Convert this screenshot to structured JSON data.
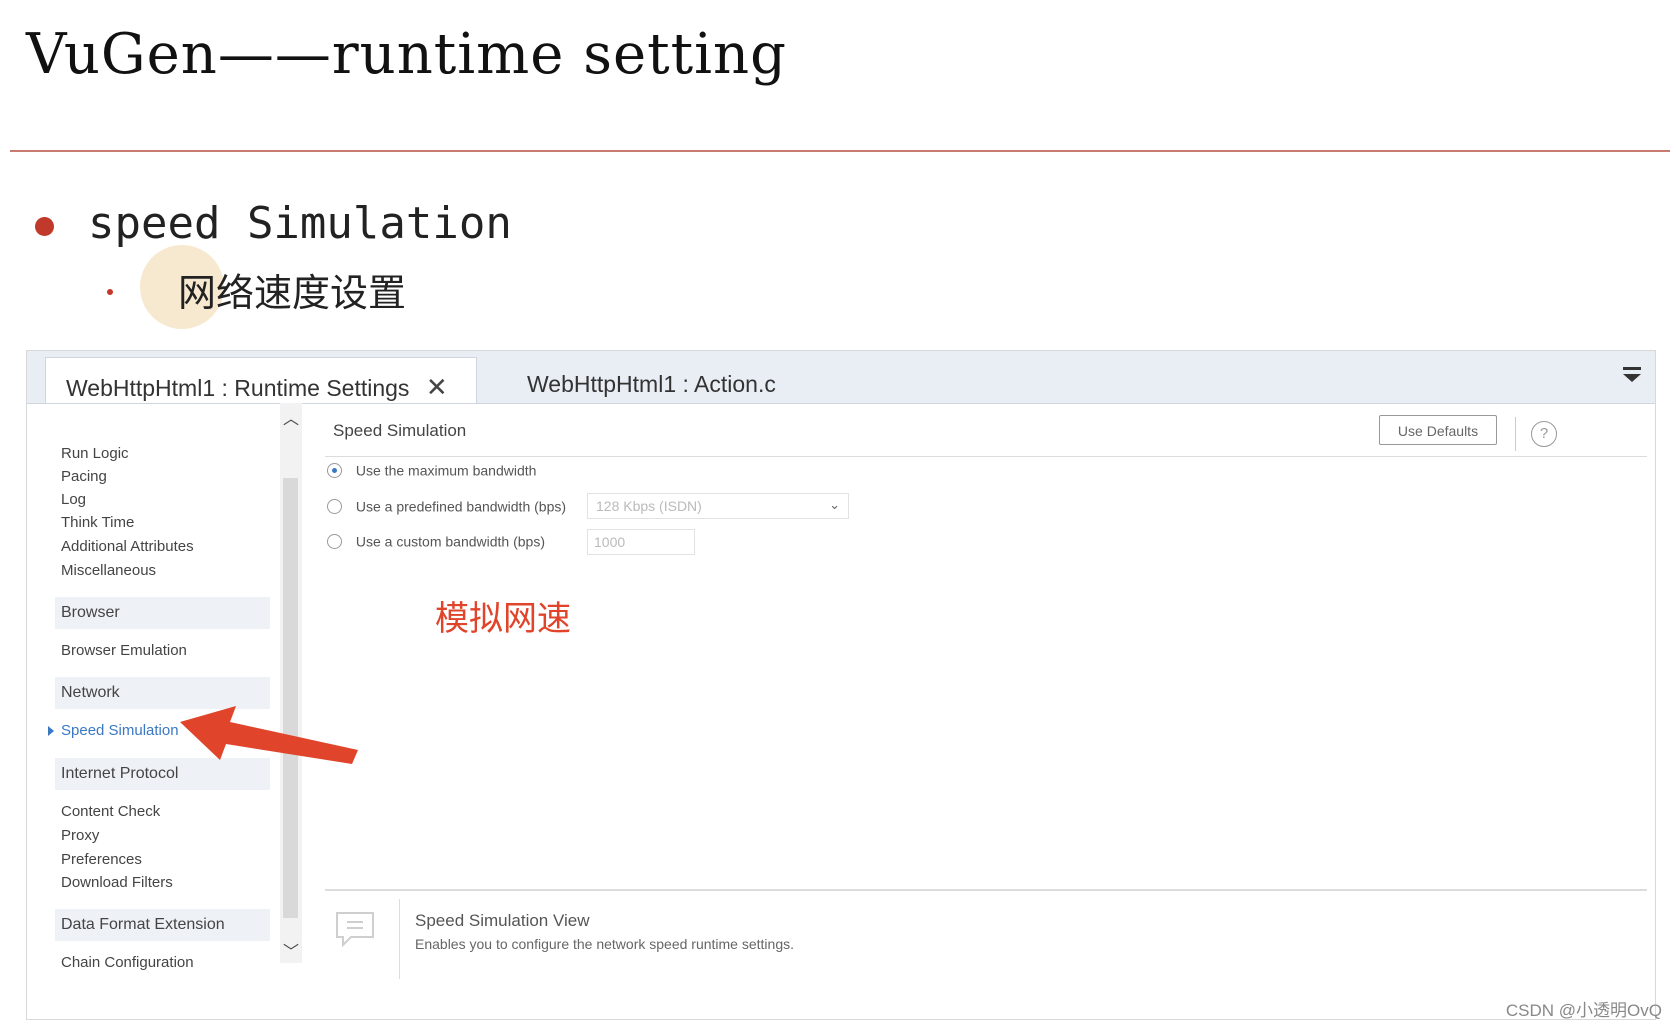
{
  "slide": {
    "title": "VuGen——runtime setting",
    "bullet": "speed Simulation",
    "sub_bullet": "网络速度设置"
  },
  "window": {
    "tabs": [
      {
        "label": "WebHttpHtml1 : Runtime Settings",
        "close": "✕"
      },
      {
        "label": "WebHttpHtml1 : Action.c"
      }
    ],
    "nav": {
      "items_top": [
        "Run Logic",
        "Pacing",
        "Log",
        "Think Time",
        "Additional Attributes",
        "Miscellaneous"
      ],
      "group_browser": "Browser",
      "browser_items": [
        "Browser Emulation"
      ],
      "group_network": "Network",
      "network_items": [
        "Speed Simulation"
      ],
      "group_internet": "Internet Protocol",
      "internet_items": [
        "Content Check",
        "Proxy",
        "Preferences",
        "Download Filters"
      ],
      "group_data": "Data Format Extension",
      "data_items": [
        "Chain Configuration"
      ],
      "selected": "Speed Simulation"
    },
    "content": {
      "title": "Speed Simulation",
      "use_defaults": "Use Defaults",
      "help": "?",
      "options": [
        {
          "label": "Use the maximum bandwidth",
          "checked": true
        },
        {
          "label": "Use a predefined bandwidth (bps)",
          "checked": false
        },
        {
          "label": "Use a custom bandwidth (bps)",
          "checked": false
        }
      ],
      "predefined_value": "128 Kbps (ISDN)",
      "custom_value": "1000",
      "annotation": "模拟网速",
      "footer_title": "Speed Simulation View",
      "footer_desc": "Enables you to configure the network speed runtime settings."
    }
  },
  "watermark": "CSDN @小透明OvQ",
  "colors": {
    "accent_red": "#e0442a",
    "link_blue": "#3a78c4",
    "rule": "#c97b72"
  }
}
